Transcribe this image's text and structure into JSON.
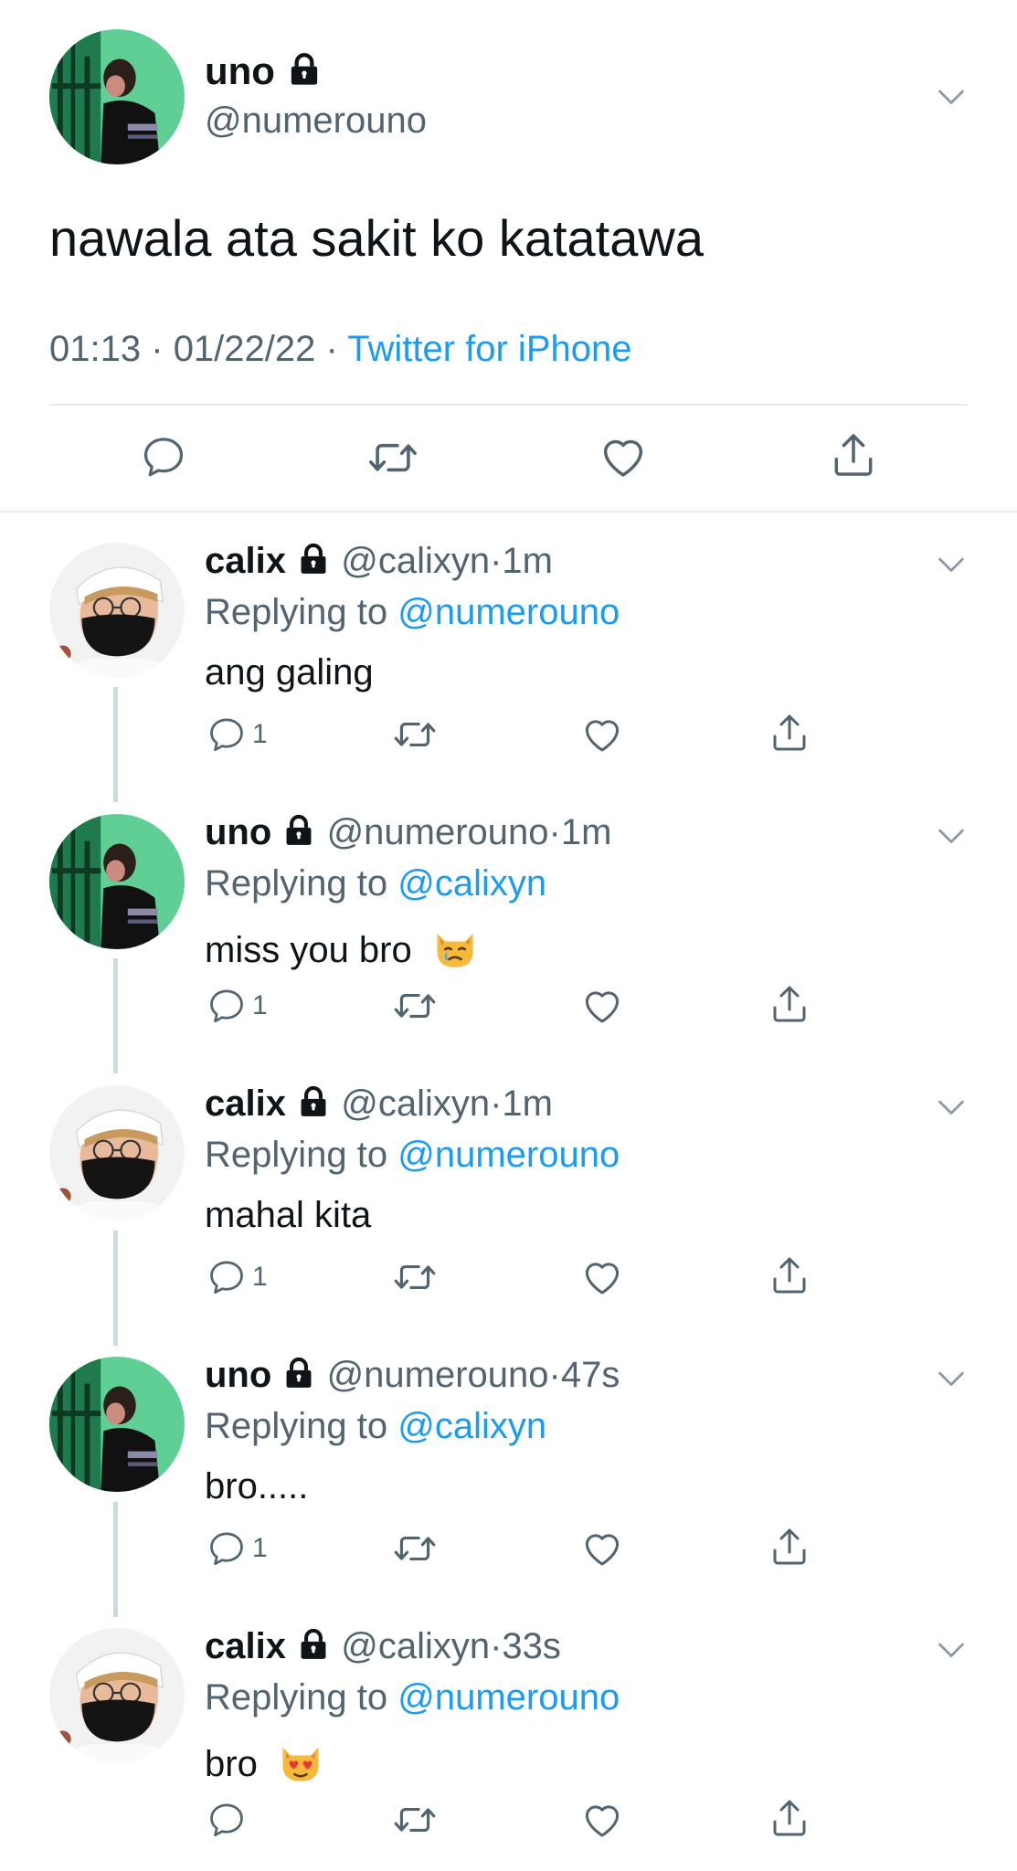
{
  "main_tweet": {
    "author_name": "uno",
    "handle": "@numerouno",
    "text": "nawala ata sakit ko katatawa",
    "time": "01:13",
    "sep1": "·",
    "date": "01/22/22",
    "sep2": "·",
    "source": "Twitter for iPhone"
  },
  "actions": {
    "reply_icon": "reply-icon",
    "retweet_icon": "retweet-icon",
    "like_icon": "heart-icon",
    "share_icon": "share-icon"
  },
  "replies": [
    {
      "author_name": "calix",
      "handle": "@calixyn",
      "sep": "·",
      "time": "1m",
      "replying_prefix": "Replying to",
      "replying_to": "@numerouno",
      "text": "ang galing",
      "emoji": "",
      "reply_count": "1"
    },
    {
      "author_name": "uno",
      "handle": "@numerouno",
      "sep": "·",
      "time": "1m",
      "replying_prefix": "Replying to",
      "replying_to": "@calixyn",
      "text": "miss you bro",
      "emoji": "crying-cat-face",
      "reply_count": "1"
    },
    {
      "author_name": "calix",
      "handle": "@calixyn",
      "sep": "·",
      "time": "1m",
      "replying_prefix": "Replying to",
      "replying_to": "@numerouno",
      "text": "mahal kita",
      "emoji": "",
      "reply_count": "1"
    },
    {
      "author_name": "uno",
      "handle": "@numerouno",
      "sep": "·",
      "time": "47s",
      "replying_prefix": "Replying to",
      "replying_to": "@calixyn",
      "text": "bro.....",
      "emoji": "",
      "reply_count": "1"
    },
    {
      "author_name": "calix",
      "handle": "@calixyn",
      "sep": "·",
      "time": "33s",
      "replying_prefix": "Replying to",
      "replying_to": "@numerouno",
      "text": "bro",
      "emoji": "heart-eyes-cat-face",
      "reply_count": ""
    }
  ],
  "colors": {
    "link_blue": "#1d9bf0",
    "secondary_gray": "#536471",
    "divider": "#e6ecf0",
    "thread_line": "#cfd9de"
  }
}
